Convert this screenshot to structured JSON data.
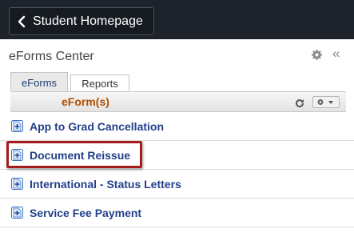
{
  "topbar": {
    "back_label": "Student Homepage",
    "back_icon": "chevron-left-icon"
  },
  "panel": {
    "title": "eForms Center",
    "settings_icon": "gear-icon",
    "collapse_icon": "«"
  },
  "tabs": [
    {
      "label": "eForms",
      "active": true
    },
    {
      "label": "Reports",
      "active": false
    }
  ],
  "grid": {
    "column_title": "eForm(s)",
    "refresh_icon": "refresh-icon",
    "settings_icon": "gear-dropdown-icon"
  },
  "rows": [
    {
      "label": "App to Grad Cancellation"
    },
    {
      "label": "Document Reissue",
      "highlighted": true
    },
    {
      "label": "International - Status Letters"
    },
    {
      "label": "Service Fee Payment"
    }
  ],
  "colors": {
    "topbar": "#1d222b",
    "link": "#23408a",
    "column_title": "#b24f00",
    "highlight_border": "#a51c1c"
  }
}
